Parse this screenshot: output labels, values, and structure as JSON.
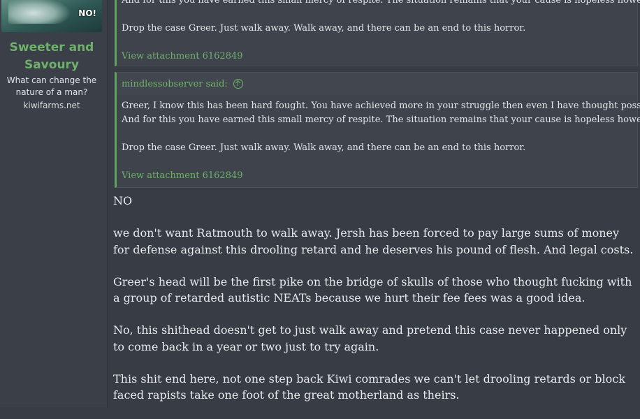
{
  "user": {
    "name": "Sweeter and Savoury",
    "title": "What can change the nature of a man?",
    "site": "kiwifarms.net",
    "avatar_badge": "NO!"
  },
  "quote_top": {
    "lines_partial": "And for this you have earned this small mercy of respite. The situation remains that your cause is hopeless however.",
    "line2": "Drop the case Greer. Just walk away. Walk away, and there can be an end to this horror.",
    "attachment": "View attachment 6162849"
  },
  "quote_main": {
    "author_said": "mindlessobserver said:",
    "line1": "Greer, I know this has been hard fought. You have achieved more in your struggle then even I have thought possible.",
    "line2": "And for this you have earned this small mercy of respite. The situation remains that your cause is hopeless however.",
    "line3": "Drop the case Greer. Just walk away. Walk away, and there can be an end to this horror.",
    "attachment": "View attachment 6162849"
  },
  "post": {
    "p1": "NO",
    "p2": "we don't want Ratmouth to walk away. Jersh has been forced to pay large sums of money for defense against this drooling retard and he deserves his pound of flesh. And legal costs.",
    "p3": "Greer's head will be the first pike on the bridge of skulls of those who thought fucking with a group of retarded autistic NEATs because we hurt their fee fees was a good idea.",
    "p4": "No, this shithead doesn't get to just walk away and pretend this case never happened only to come back in a year or two just to try again.",
    "p5": "This shit end here, not one step back Kiwi comrades we can't let drooling retards or block faced rapists take one foot of the great motherland as theirs."
  },
  "colors": {
    "background": "#383c44",
    "accent_green": "#6fb06b",
    "text": "#e8eaed"
  }
}
